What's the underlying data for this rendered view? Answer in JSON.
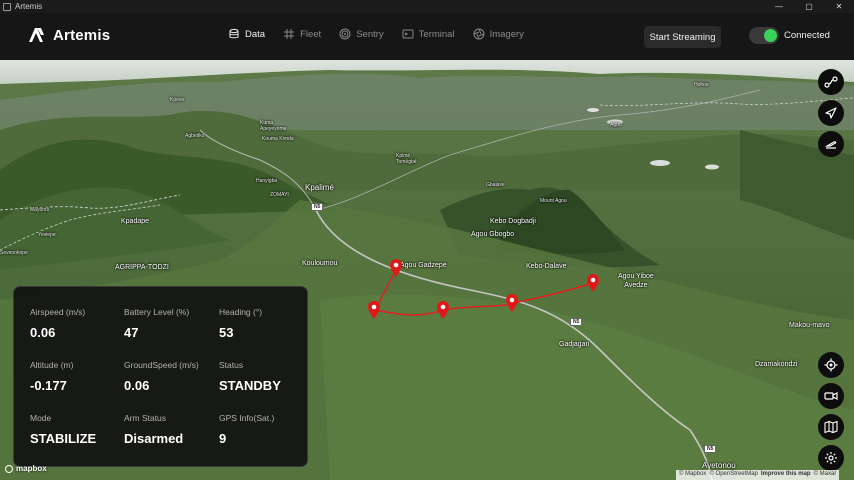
{
  "window": {
    "title": "Artemis",
    "controls": [
      "—",
      "▢",
      "✕"
    ]
  },
  "brand": {
    "name": "Artemis"
  },
  "tabs": [
    {
      "label": "Data",
      "icon": "database-icon",
      "active": true
    },
    {
      "label": "Fleet",
      "icon": "grid-hash-icon",
      "active": false
    },
    {
      "label": "Sentry",
      "icon": "radar-icon",
      "active": false
    },
    {
      "label": "Terminal",
      "icon": "terminal-icon",
      "active": false
    },
    {
      "label": "Imagery",
      "icon": "aperture-icon",
      "active": false
    }
  ],
  "toolbar": {
    "stream_label": "Start Streaming",
    "connection_label": "Connected",
    "connected": true,
    "accent": "#3bd35b"
  },
  "map": {
    "places": {
      "kpalime": "Kpalimé",
      "kpadape": "Kpadape",
      "agrippa": "AGRIPPA-TODZI",
      "kouloumou": "Kouloumou",
      "agou_gadzepe": "Agou Gadzepe",
      "agou_iboe": "Agou Yiboe\nAvedze",
      "kebo_dogbadji": "Kebo Dogbadji",
      "agou_gbogbo": "Agou Gbogbo",
      "kebo_dalave": "Kebo-Dalave",
      "mount_agou": "Mount Agou",
      "gadjagan": "Gadjagan",
      "makou": "Makou-mavo",
      "dzamakondzi": "Dzamakondzi",
      "avetonou": "Avetonou",
      "mayondi": "Mayondi",
      "yeviepe": "Yeviepe",
      "sevenokope": "Sevenokope",
      "hanyigba": "Hanyigba",
      "zomayi": "ZOMAYI",
      "kpimé": "Kpimé\nTomégbé",
      "gbalave": "Gbalave",
      "kuma": "Kuma\nApeyeyeme",
      "kouma_konda": "Kouma Konda",
      "agbetiko": "Agbetiko",
      "kpeve": "Kpeve",
      "hohoe": "Hohoe",
      "agbo": "Agbo"
    },
    "roads": [
      "N5",
      "N5",
      "N5"
    ],
    "route_color": "#e02020",
    "marker_color": "#e01818",
    "attribution": {
      "mapbox": "© Mapbox",
      "osm": "© OpenStreetMap",
      "improve": "Improve this map",
      "maxar": "© Maxar"
    },
    "logo": "mapbox"
  },
  "side_buttons": [
    {
      "icon": "route-share-icon"
    },
    {
      "icon": "navigation-arrow-icon"
    },
    {
      "icon": "takeoff-icon"
    },
    {
      "icon": "locate-target-icon"
    },
    {
      "icon": "video-camera-icon"
    },
    {
      "icon": "map-icon"
    },
    {
      "icon": "settings-gear-icon"
    }
  ],
  "telemetry": {
    "airspeed": {
      "label": "Airspeed (m/s)",
      "value": "0.06"
    },
    "battery": {
      "label": "Battery Level (%)",
      "value": "47"
    },
    "heading": {
      "label": "Heading (°)",
      "value": "53"
    },
    "altitude": {
      "label": "Altitude (m)",
      "value": "-0.177"
    },
    "groundspeed": {
      "label": "GroundSpeed (m/s)",
      "value": "0.06"
    },
    "status": {
      "label": "Status",
      "value": "STANDBY"
    },
    "mode": {
      "label": "Mode",
      "value": "STABILIZE"
    },
    "arm": {
      "label": "Arm Status",
      "value": "Disarmed"
    },
    "gps": {
      "label": "GPS Info(Sat.)",
      "value": "9"
    }
  }
}
